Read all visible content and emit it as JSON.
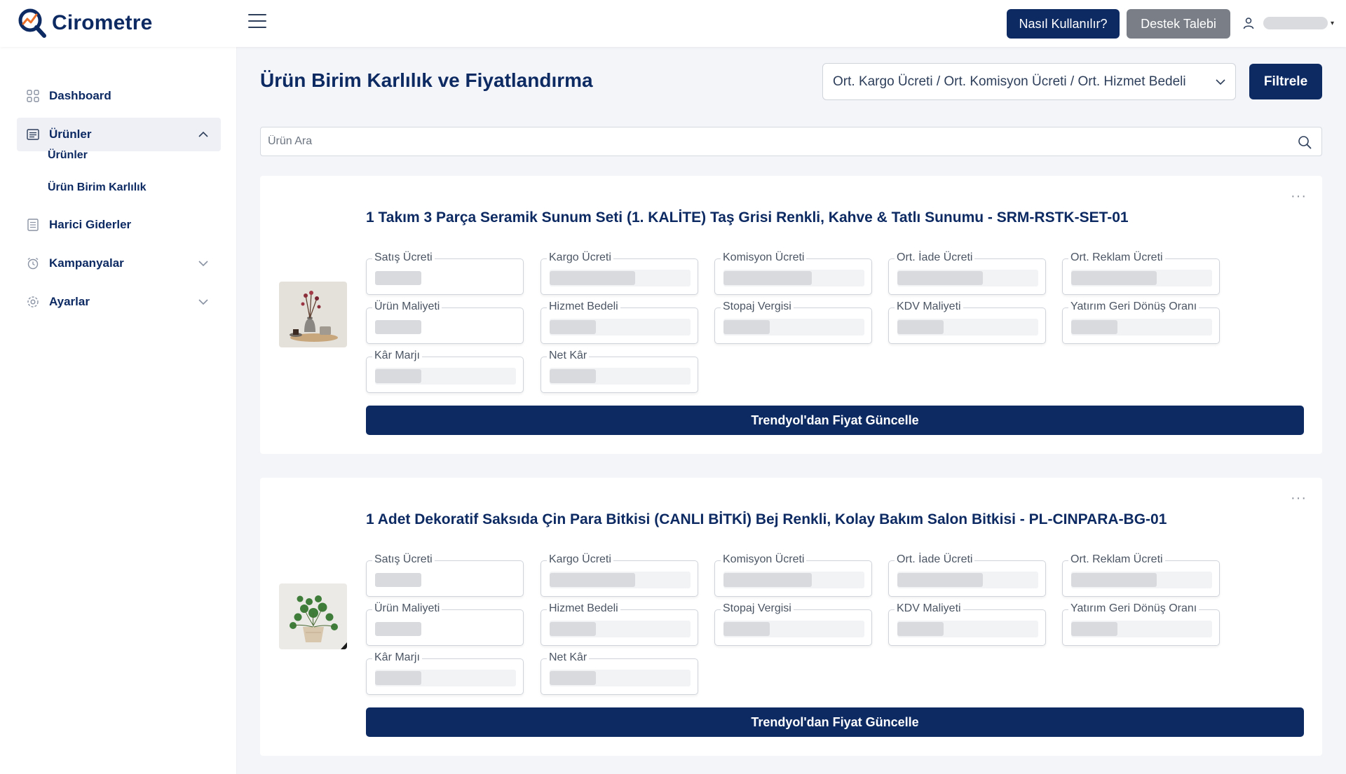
{
  "header": {
    "brand": "Cirometre",
    "how_to_label": "Nasıl Kullanılır?",
    "support_label": "Destek Talebi"
  },
  "sidebar": {
    "items": [
      {
        "label": "Dashboard",
        "icon": "grid-icon"
      },
      {
        "label": "Ürünler",
        "icon": "list-icon",
        "expanded": true
      },
      {
        "label": "Harici Giderler",
        "icon": "document-icon"
      },
      {
        "label": "Kampanyalar",
        "icon": "alarm-clock-icon"
      },
      {
        "label": "Ayarlar",
        "icon": "gear-icon"
      }
    ],
    "sub_items": [
      {
        "label": "Ürünler"
      },
      {
        "label": "Ürün Birim Karlılık"
      }
    ]
  },
  "main": {
    "title": "Ürün Birim Karlılık ve Fiyatlandırma",
    "filter_value": "Ort. Kargo Ücreti / Ort. Komisyon Ücreti / Ort. Hizmet Bedeli",
    "filter_button": "Filtrele",
    "search_placeholder": "Ürün Ara"
  },
  "field_labels": [
    "Satış Ücreti",
    "Kargo Ücreti",
    "Komisyon Ücreti",
    "Ort. İade Ücreti",
    "Ort. Reklam Ücreti",
    "Ürün Maliyeti",
    "Hizmet Bedeli",
    "Stopaj Vergisi",
    "KDV Maliyeti",
    "Yatırım Geri Dönüş Oranı",
    "Kâr Marjı",
    "Net Kâr"
  ],
  "products": [
    {
      "title": "1 Takım 3 Parça Seramik Sunum Seti (1. KALİTE) Taş Grisi Renkli, Kahve & Tatlı Sunumu - SRM-RSTK-SET-01",
      "image": "ceramic-serving-set-photo",
      "update_button": "Trendyol'dan Fiyat Güncelle"
    },
    {
      "title": "1 Adet Dekoratif Saksıda Çin Para Bitkisi (CANLI BİTKİ) Bej Renkli, Kolay Bakım Salon Bitkisi - PL-CINPARA-BG-01",
      "image": "money-plant-pot-photo",
      "update_button": "Trendyol'dan Fiyat Güncelle"
    }
  ],
  "colors": {
    "primary": "#0d2a63",
    "secondary_button": "#7a7f87",
    "background": "#f4f5f9",
    "skeleton": "#d8dadd"
  }
}
